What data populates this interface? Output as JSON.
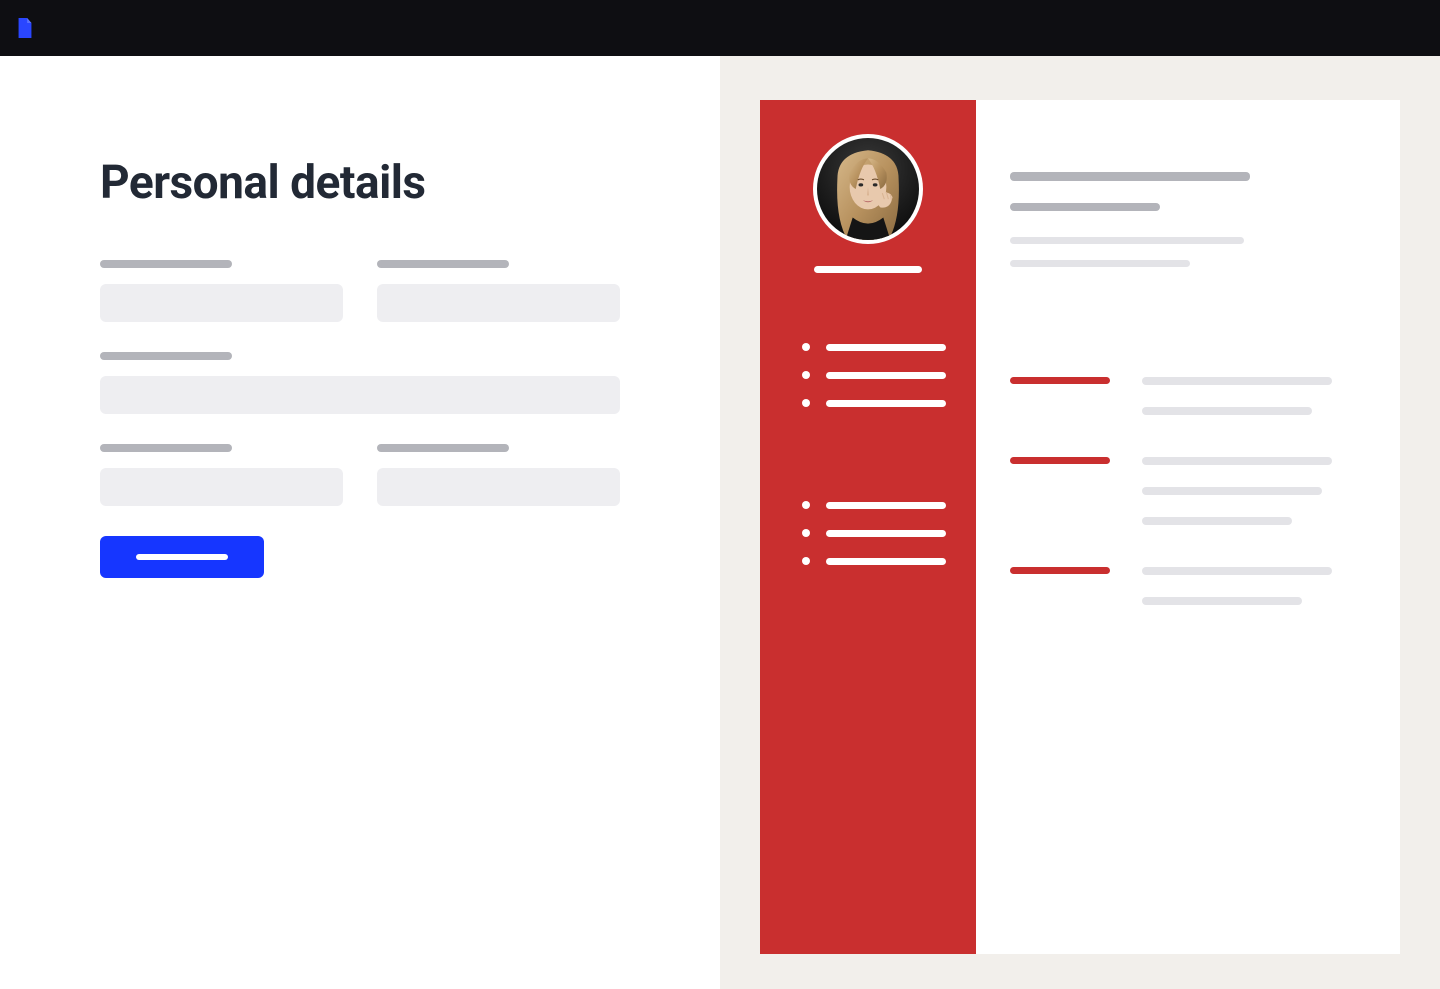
{
  "header": {
    "logo_name": "file-icon"
  },
  "form": {
    "title": "Personal details",
    "fields": {
      "row1_left_label": "",
      "row1_right_label": "",
      "row2_label": "",
      "row3_left_label": "",
      "row3_right_label": ""
    },
    "submit_label": ""
  },
  "preview": {
    "sidebar": {
      "name_line": "",
      "group1": [
        "",
        "",
        ""
      ],
      "group2": [
        "",
        "",
        ""
      ]
    },
    "main": {
      "heading_lines": [
        "",
        "",
        "",
        ""
      ],
      "entries": [
        {
          "date": "",
          "lines": [
            "",
            ""
          ]
        },
        {
          "date": "",
          "lines": [
            "",
            "",
            ""
          ]
        },
        {
          "date": "",
          "lines": [
            "",
            ""
          ]
        }
      ]
    }
  },
  "colors": {
    "accent": "#1636ff",
    "resume_side": "#c92f2f",
    "topbar": "#0e0e12",
    "preview_bg": "#f2efeb"
  }
}
